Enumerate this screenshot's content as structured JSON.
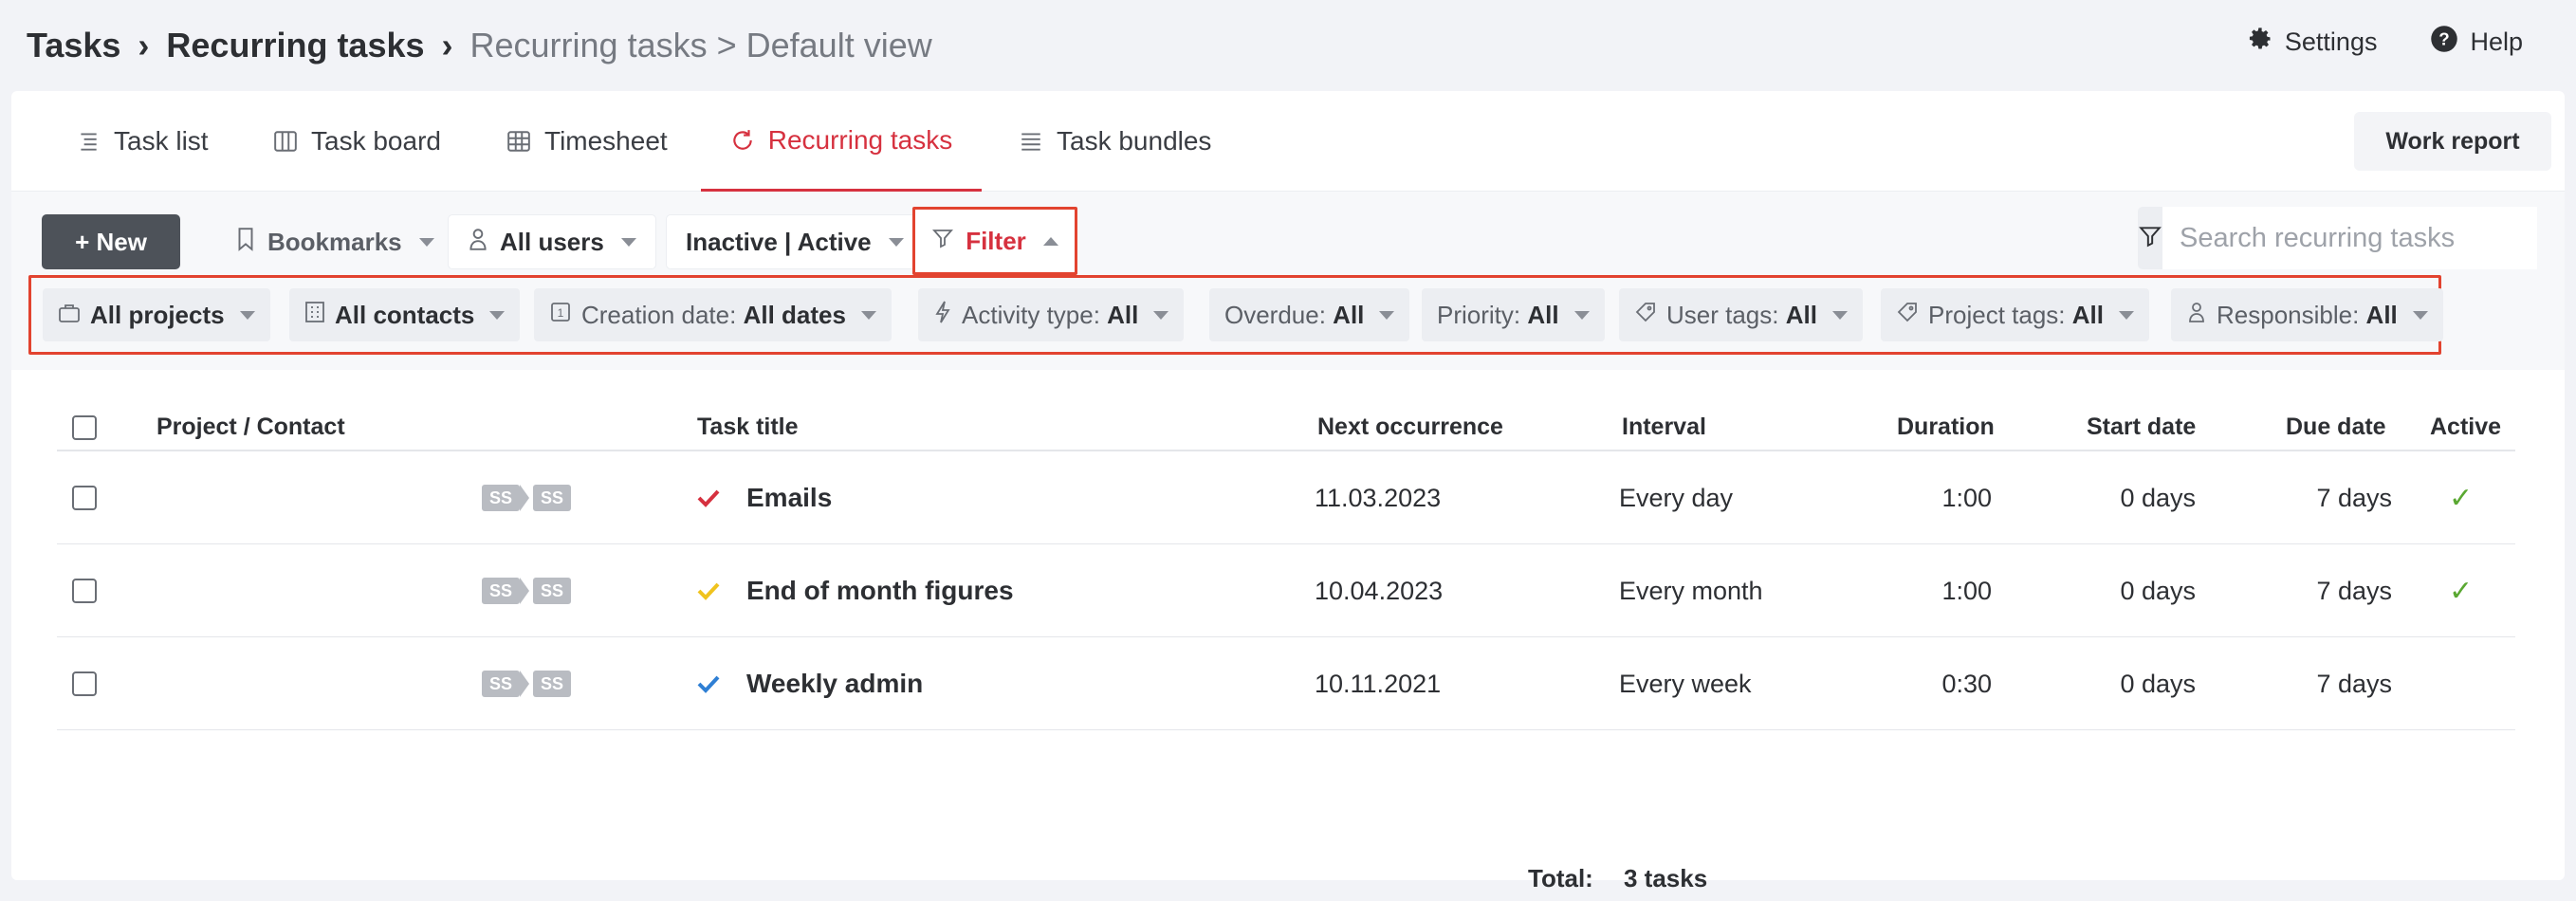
{
  "breadcrumb": {
    "item1": "Tasks",
    "sep1": "›",
    "item2": "Recurring tasks",
    "sep2": "›",
    "item3": "Recurring tasks > Default view"
  },
  "top_links": {
    "settings": "Settings",
    "help": "Help"
  },
  "tabs": [
    {
      "label": "Task list",
      "icon": "list-icon"
    },
    {
      "label": "Task board",
      "icon": "board-icon"
    },
    {
      "label": "Timesheet",
      "icon": "grid-icon"
    },
    {
      "label": "Recurring tasks",
      "icon": "refresh-icon",
      "active": true
    },
    {
      "label": "Task bundles",
      "icon": "bundle-icon"
    }
  ],
  "work_report": "Work report",
  "toolbar": {
    "new": "+ New",
    "bookmarks": "Bookmarks",
    "all_users": "All users",
    "inactive_active": "Inactive | Active",
    "filter": "Filter",
    "search_placeholder": "Search recurring tasks"
  },
  "chips": [
    {
      "label": "",
      "value": "All projects"
    },
    {
      "label": "",
      "value": "All contacts"
    },
    {
      "label": "Creation date: ",
      "value": "All dates"
    },
    {
      "label": "Activity type: ",
      "value": "All"
    },
    {
      "label": "Overdue: ",
      "value": "All"
    },
    {
      "label": "Priority: ",
      "value": "All"
    },
    {
      "label": "User tags: ",
      "value": "All"
    },
    {
      "label": "Project tags: ",
      "value": "All"
    },
    {
      "label": "Responsible: ",
      "value": "All"
    }
  ],
  "table": {
    "columns": {
      "project": "Project / Contact",
      "title": "Task title",
      "next": "Next occurrence",
      "interval": "Interval",
      "duration": "Duration",
      "start": "Start date",
      "due": "Due date",
      "active": "Active"
    },
    "rows": [
      {
        "badge1": "SS",
        "badge2": "SS",
        "title": "Emails",
        "check_color": "#d6313f",
        "next": "11.03.2023",
        "interval": "Every day",
        "duration": "1:00",
        "start": "0 days",
        "due": "7 days",
        "active": "✓"
      },
      {
        "badge1": "SS",
        "badge2": "SS",
        "title": "End of month figures",
        "check_color": "#f0c31e",
        "next": "10.04.2023",
        "interval": "Every month",
        "duration": "1:00",
        "start": "0 days",
        "due": "7 days",
        "active": "✓"
      },
      {
        "badge1": "SS",
        "badge2": "SS",
        "title": "Weekly admin",
        "check_color": "#2f7fd4",
        "next": "10.11.2021",
        "interval": "Every week",
        "duration": "0:30",
        "start": "0 days",
        "due": "7 days",
        "active": ""
      }
    ],
    "total_label": "Total:",
    "total_value": "3 tasks"
  },
  "colors": {
    "accent": "#d6313f",
    "highlight_border": "#e2432f",
    "active_check": "#5aa832"
  }
}
